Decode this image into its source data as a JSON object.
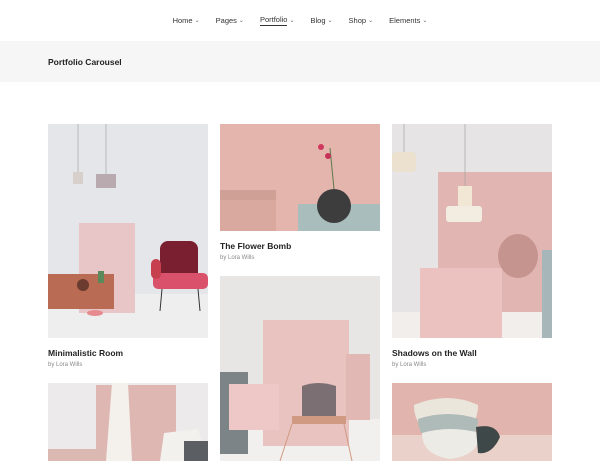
{
  "nav": {
    "items": [
      {
        "label": "Home",
        "active": false
      },
      {
        "label": "Pages",
        "active": false
      },
      {
        "label": "Portfolio",
        "active": true
      },
      {
        "label": "Blog",
        "active": false
      },
      {
        "label": "Shop",
        "active": false
      },
      {
        "label": "Elements",
        "active": false
      }
    ],
    "chevron": "⌄"
  },
  "page": {
    "title": "Portfolio Carousel"
  },
  "portfolio": [
    {
      "title": "Minimalistic Room",
      "author": "by Lora Wills"
    },
    {
      "title": "The Flower Bomb",
      "author": "by Lora Wills"
    },
    {
      "title": "Shadows on the Wall",
      "author": "by Lora Wills"
    }
  ],
  "colors": {
    "accent": "#e5c1bc",
    "title_bar_bg": "#f6f6f6"
  }
}
